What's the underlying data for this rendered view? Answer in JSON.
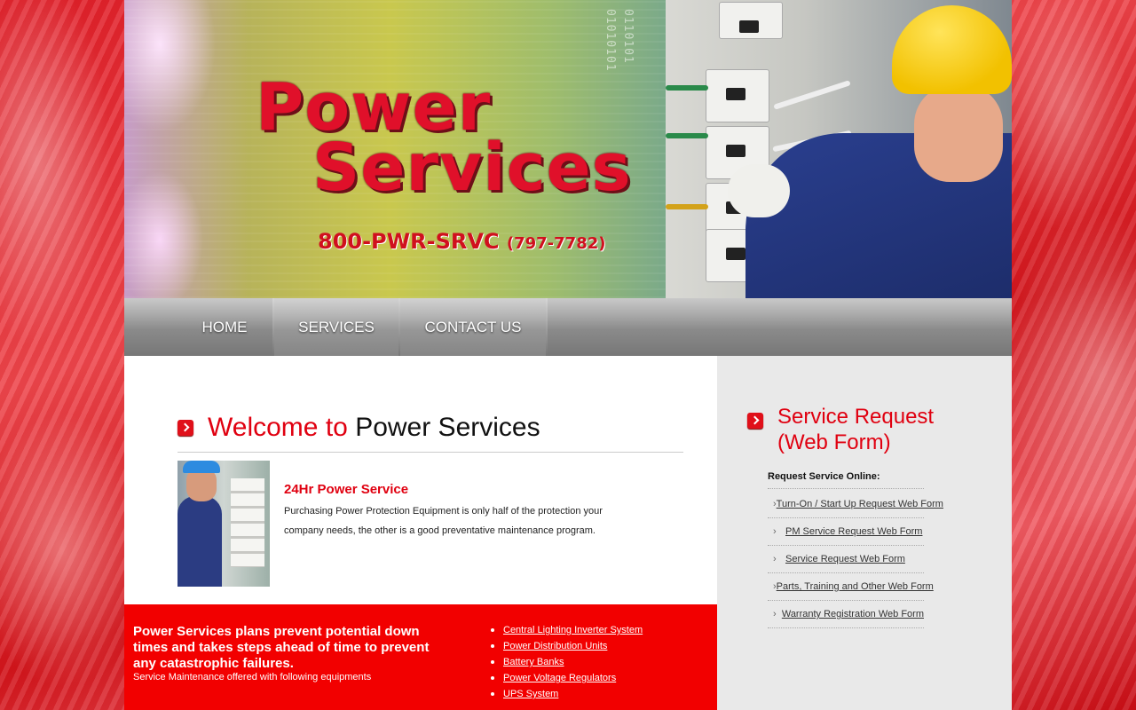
{
  "header": {
    "brand_line1": "Power",
    "brand_line2": "Services",
    "phone": "800-PWR-SRVC",
    "phone_number": "(797-7782)",
    "binary_1": "01010101",
    "binary_2": "0110101"
  },
  "nav": {
    "items": [
      {
        "label": "HOME"
      },
      {
        "label": "SERVICES"
      },
      {
        "label": "CONTACT US"
      }
    ]
  },
  "main": {
    "welcome_red": "Welcome to",
    "welcome_black": "Power Services",
    "service_title": "24Hr Power Service",
    "service_text": "Purchasing Power Protection Equipment is only half of the protection your company needs, the other is a good preventative maintenance program."
  },
  "band": {
    "headline": "Power Services plans prevent potential down times and takes steps ahead of time to prevent any catastrophic failures.",
    "subtext": "Service Maintenance offered with following equipments",
    "equipment": [
      "Central Lighting Inverter System",
      "Power Distribution Units",
      "Battery Banks",
      "Power Voltage Regulators",
      "UPS System"
    ]
  },
  "sidebar": {
    "title": "Service Request (Web Form)",
    "request_label": "Request Service Online:",
    "links": [
      "Turn-On / Start Up Request Web Form",
      "PM Service Request Web Form",
      "Service Request Web Form",
      "Parts, Training and Other Web Form",
      "Warranty Registration Web Form"
    ]
  },
  "colors": {
    "accent_red": "#e00010",
    "band_red": "#f20000",
    "nav_gray": "#8a8a8a",
    "sidebar_bg": "#e9e9e9"
  }
}
